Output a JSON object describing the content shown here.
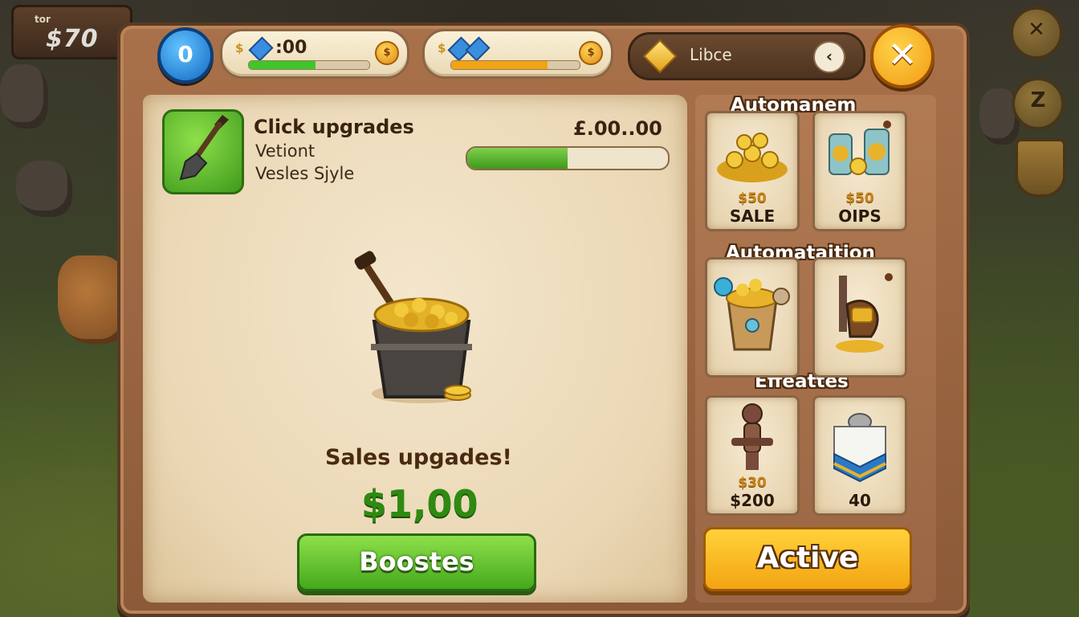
{
  "hud": {
    "money_label": "tor",
    "money_value": "$70"
  },
  "topbar": {
    "level_value": "0",
    "resource1": {
      "value": ":00",
      "fill": 0.55,
      "color": "#3fc62a"
    },
    "resource2": {
      "value": "",
      "fill": 0.75,
      "color": "#f1a414"
    },
    "search_text": "Libce",
    "back_glyph": "‹",
    "close_glyph": "✕"
  },
  "main": {
    "title": "Click upgrades",
    "line1": "Vetiont",
    "line2": "Vesles Sjyle",
    "price": "£.00..00",
    "progress": 0.5,
    "center_title": "Sales upgades!",
    "center_price": "$1,00",
    "boost_label": "Boostes"
  },
  "sidebar": {
    "section1": "Automanem",
    "section2": "Automataition",
    "section3": "Effeattes",
    "cards": [
      {
        "price": "$50",
        "label": "SALE",
        "corner": ""
      },
      {
        "price": "$50",
        "label": "OIPS",
        "corner": ""
      },
      {
        "price": "",
        "label": "",
        "corner": ""
      },
      {
        "price": "",
        "label": "",
        "corner": ""
      },
      {
        "price": "$30",
        "label": "$200",
        "corner": ""
      },
      {
        "price": "",
        "label": "40",
        "corner": ""
      }
    ],
    "active_label": "Active"
  },
  "icons": {
    "shovel": "shovel-icon",
    "bucket": "gold-bucket-icon",
    "coins": "coins-icon"
  },
  "colors": {
    "green_accent": "#3f9a1c",
    "gold_accent": "#f3a412",
    "wood": "#8c5a38",
    "parchment": "#ead7b4"
  }
}
